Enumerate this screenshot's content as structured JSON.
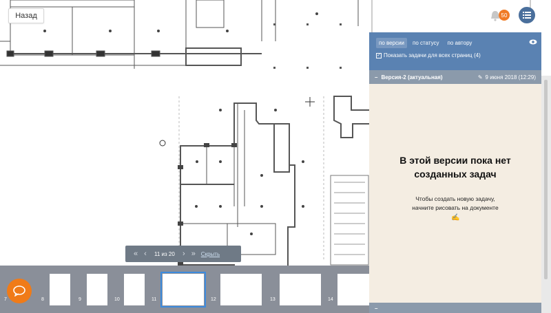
{
  "toolbar": {
    "back_label": "Назад"
  },
  "notifications": {
    "count": "50",
    "icon": "bell-icon"
  },
  "menu": {
    "icon": "list-icon"
  },
  "panel": {
    "filters": [
      "по версии",
      "по статусу",
      "по автору"
    ],
    "active_filter": "по версии",
    "show_all_label": "Показать задачи для всех страниц (4)",
    "show_all_checked": true,
    "version": {
      "name": "Версия-2 (актуальная)",
      "date": "9 июня 2018 (12:29)"
    },
    "empty_title_line1": "В этой версии пока нет",
    "empty_title_line2": "созданных задач",
    "empty_sub_line1": "Чтобы создать новую задачу,",
    "empty_sub_line2": "начните рисовать на документе"
  },
  "pager": {
    "current": "11 из 20",
    "hide_label": "Скрыть"
  },
  "thumbnails": [
    {
      "num": "7"
    },
    {
      "num": "8"
    },
    {
      "num": "9"
    },
    {
      "num": "10"
    },
    {
      "num": "11"
    },
    {
      "num": "12"
    },
    {
      "num": "13"
    },
    {
      "num": "14"
    }
  ],
  "active_thumbnail": "11",
  "colors": {
    "accent": "#5a82b2",
    "orange": "#f07b18",
    "panel_bg": "#f4ede2",
    "thumbbar": "#8a8f99"
  }
}
